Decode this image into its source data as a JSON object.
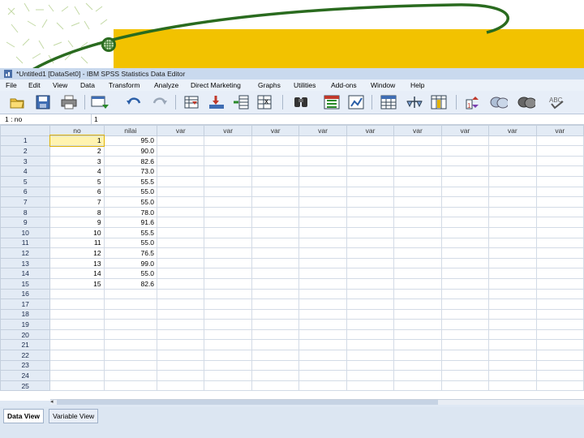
{
  "window": {
    "title": "*Untitled1 [DataSet0] - IBM SPSS Statistics Data Editor"
  },
  "menu": [
    "File",
    "Edit",
    "View",
    "Data",
    "Transform",
    "Analyze",
    "Direct Marketing",
    "Graphs",
    "Utilities",
    "Add-ons",
    "Window",
    "Help"
  ],
  "toolbar": {
    "icons": [
      "open-icon",
      "save-icon",
      "print-icon",
      "dialog-recall-icon",
      "undo-icon",
      "redo-icon",
      "goto-case-icon",
      "goto-variable-icon",
      "variables-icon",
      "insert-cases-icon",
      "find-icon",
      "split-file-icon",
      "weight-cases-icon",
      "value-labels-icon",
      "insert-variable-icon",
      "select-cases-icon",
      "show-sets-icon",
      "use-sets-icon",
      "spell-check-icon"
    ]
  },
  "cell_editor": {
    "reference": "1 : no",
    "value": "1"
  },
  "grid": {
    "columns": [
      "no",
      "nilai",
      "var",
      "var",
      "var",
      "var",
      "var",
      "var",
      "var",
      "var",
      "var"
    ],
    "row_numbers": [
      "1",
      "2",
      "3",
      "4",
      "5",
      "6",
      "7",
      "8",
      "9",
      "10",
      "11",
      "12",
      "13",
      "14",
      "15",
      "16",
      "17",
      "18",
      "19",
      "20",
      "21",
      "22",
      "23",
      "24",
      "25"
    ],
    "rows": [
      [
        "1",
        "95.0"
      ],
      [
        "2",
        "90.0"
      ],
      [
        "3",
        "82.6"
      ],
      [
        "4",
        "73.0"
      ],
      [
        "5",
        "55.5"
      ],
      [
        "6",
        "55.0"
      ],
      [
        "7",
        "55.0"
      ],
      [
        "8",
        "78.0"
      ],
      [
        "9",
        "91.6"
      ],
      [
        "10",
        "55.5"
      ],
      [
        "11",
        "55.0"
      ],
      [
        "12",
        "76.5"
      ],
      [
        "13",
        "99.0"
      ],
      [
        "14",
        "55.0"
      ],
      [
        "15",
        "82.6"
      ]
    ]
  },
  "tabs": [
    "Data View",
    "Variable View"
  ],
  "colors": {
    "slide_band": "#f2c200",
    "slide_curve": "#2a6b1f",
    "selection": "#fff3b0"
  }
}
